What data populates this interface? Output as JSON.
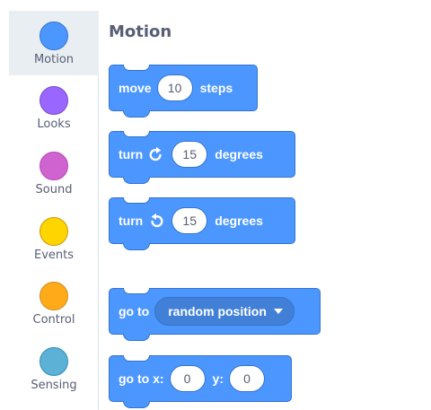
{
  "categories": [
    {
      "label": "Motion",
      "color": "#4c97ff",
      "border": "#3373cc",
      "selected": true
    },
    {
      "label": "Looks",
      "color": "#9966ff",
      "border": "#774dcb",
      "selected": false
    },
    {
      "label": "Sound",
      "color": "#cf63cf",
      "border": "#bd42bd",
      "selected": false
    },
    {
      "label": "Events",
      "color": "#ffd500",
      "border": "#cc9900",
      "selected": false
    },
    {
      "label": "Control",
      "color": "#ffab19",
      "border": "#cf8b17",
      "selected": false
    },
    {
      "label": "Sensing",
      "color": "#5cb1d6",
      "border": "#2e8eb8",
      "selected": false
    }
  ],
  "palette": {
    "title": "Motion",
    "blocks": {
      "move": {
        "word1": "move",
        "value": "10",
        "word2": "steps"
      },
      "turn_right": {
        "word1": "turn",
        "icon": "rotate-clockwise-icon",
        "value": "15",
        "word2": "degrees"
      },
      "turn_left": {
        "word1": "turn",
        "icon": "rotate-counterclockwise-icon",
        "value": "15",
        "word2": "degrees"
      },
      "goto": {
        "word1": "go to",
        "dropdown": "random position"
      },
      "goto_xy": {
        "word1": "go to x:",
        "x": "0",
        "word2": "y:",
        "y": "0"
      }
    }
  },
  "colors": {
    "motion_block": "#4c97ff",
    "motion_border": "#3373cc",
    "label_text": "#575e75",
    "selected_bg": "#e9eef2"
  }
}
